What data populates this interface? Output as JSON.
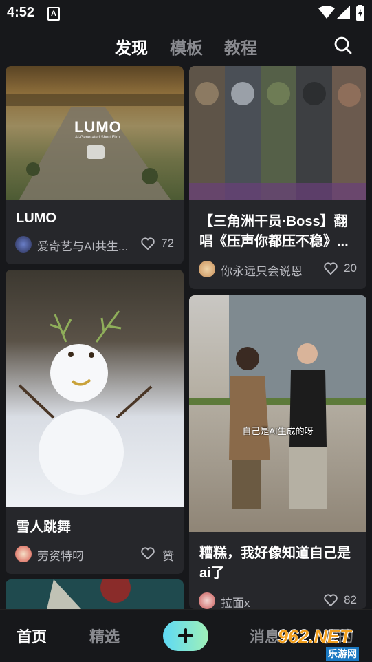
{
  "status_bar": {
    "time": "4:52",
    "notification_icon": "A"
  },
  "top_tabs": [
    {
      "label": "发现",
      "active": true
    },
    {
      "label": "模板",
      "active": false
    },
    {
      "label": "教程",
      "active": false
    }
  ],
  "cards": [
    {
      "thumb_text": "LUMO",
      "thumb_subtext": "AI-Generated Short Film",
      "title": "LUMO",
      "author": "爱奇艺与AI共生...",
      "likes": "72"
    },
    {
      "title": "【三角洲干员·Boss】翻唱《压声你都压不稳》...",
      "author": "你永远只会说恩",
      "likes": "20"
    },
    {
      "title": "雪人跳舞",
      "author": "劳资特叼",
      "likes": "赞"
    },
    {
      "subtitle_text": "自己是AI生成的呀",
      "title": "糟糕，我好像知道自己是ai了",
      "author": "拉面x",
      "likes": "82"
    }
  ],
  "bottom_nav": {
    "home": "首页",
    "featured": "精选",
    "messages": "消息",
    "profile": "我的"
  },
  "watermark": {
    "main": "962.NET",
    "sub": "乐游网"
  }
}
